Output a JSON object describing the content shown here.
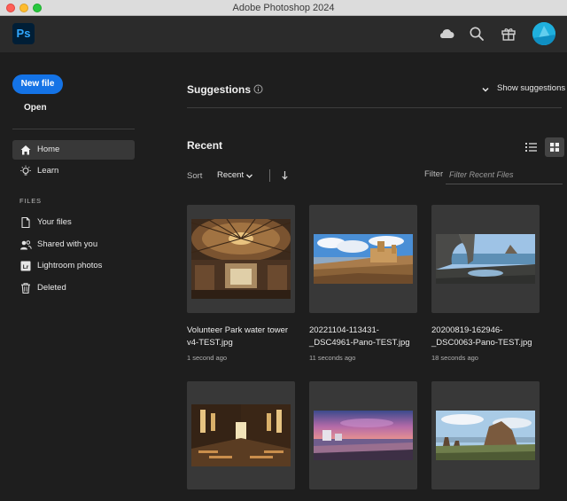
{
  "window": {
    "title": "Adobe Photoshop 2024"
  },
  "app_header": {
    "logo_text": "Ps",
    "icons": [
      "cloud-icon",
      "search-icon",
      "gift-icon",
      "avatar"
    ]
  },
  "sidebar": {
    "new_file": "New file",
    "open": "Open",
    "nav": [
      {
        "label": "Home",
        "icon": "home-icon",
        "active": true
      },
      {
        "label": "Learn",
        "icon": "lightbulb-icon",
        "active": false
      }
    ],
    "files_header": "FILES",
    "files": [
      {
        "label": "Your files",
        "icon": "document-icon"
      },
      {
        "label": "Shared with you",
        "icon": "shared-users-icon"
      },
      {
        "label": "Lightroom photos",
        "icon": "lightroom-icon",
        "icon_text": "Lr"
      },
      {
        "label": "Deleted",
        "icon": "trash-icon"
      }
    ]
  },
  "suggestions": {
    "title": "Suggestions",
    "show_label": "Show suggestions"
  },
  "recent": {
    "title": "Recent",
    "sort_label": "Sort",
    "sort_value": "Recent",
    "filter_label": "Filter",
    "filter_placeholder": "Filter Recent Files",
    "view_mode": "grid",
    "files": [
      {
        "name": "Volunteer Park water tower v4-TEST.jpg",
        "time": "1 second ago"
      },
      {
        "name": "20221104-113431-_DSC4961-Pano-TEST.jpg",
        "time": "11 seconds ago"
      },
      {
        "name": "20200819-162946-_DSC0063-Pano-TEST.jpg",
        "time": "18 seconds ago"
      },
      {
        "name": "",
        "time": ""
      },
      {
        "name": "",
        "time": ""
      },
      {
        "name": "",
        "time": ""
      }
    ]
  },
  "colors": {
    "accent": "#1473e6",
    "background": "#1e1e1e",
    "header": "#2b2b2b",
    "card": "#383838"
  }
}
